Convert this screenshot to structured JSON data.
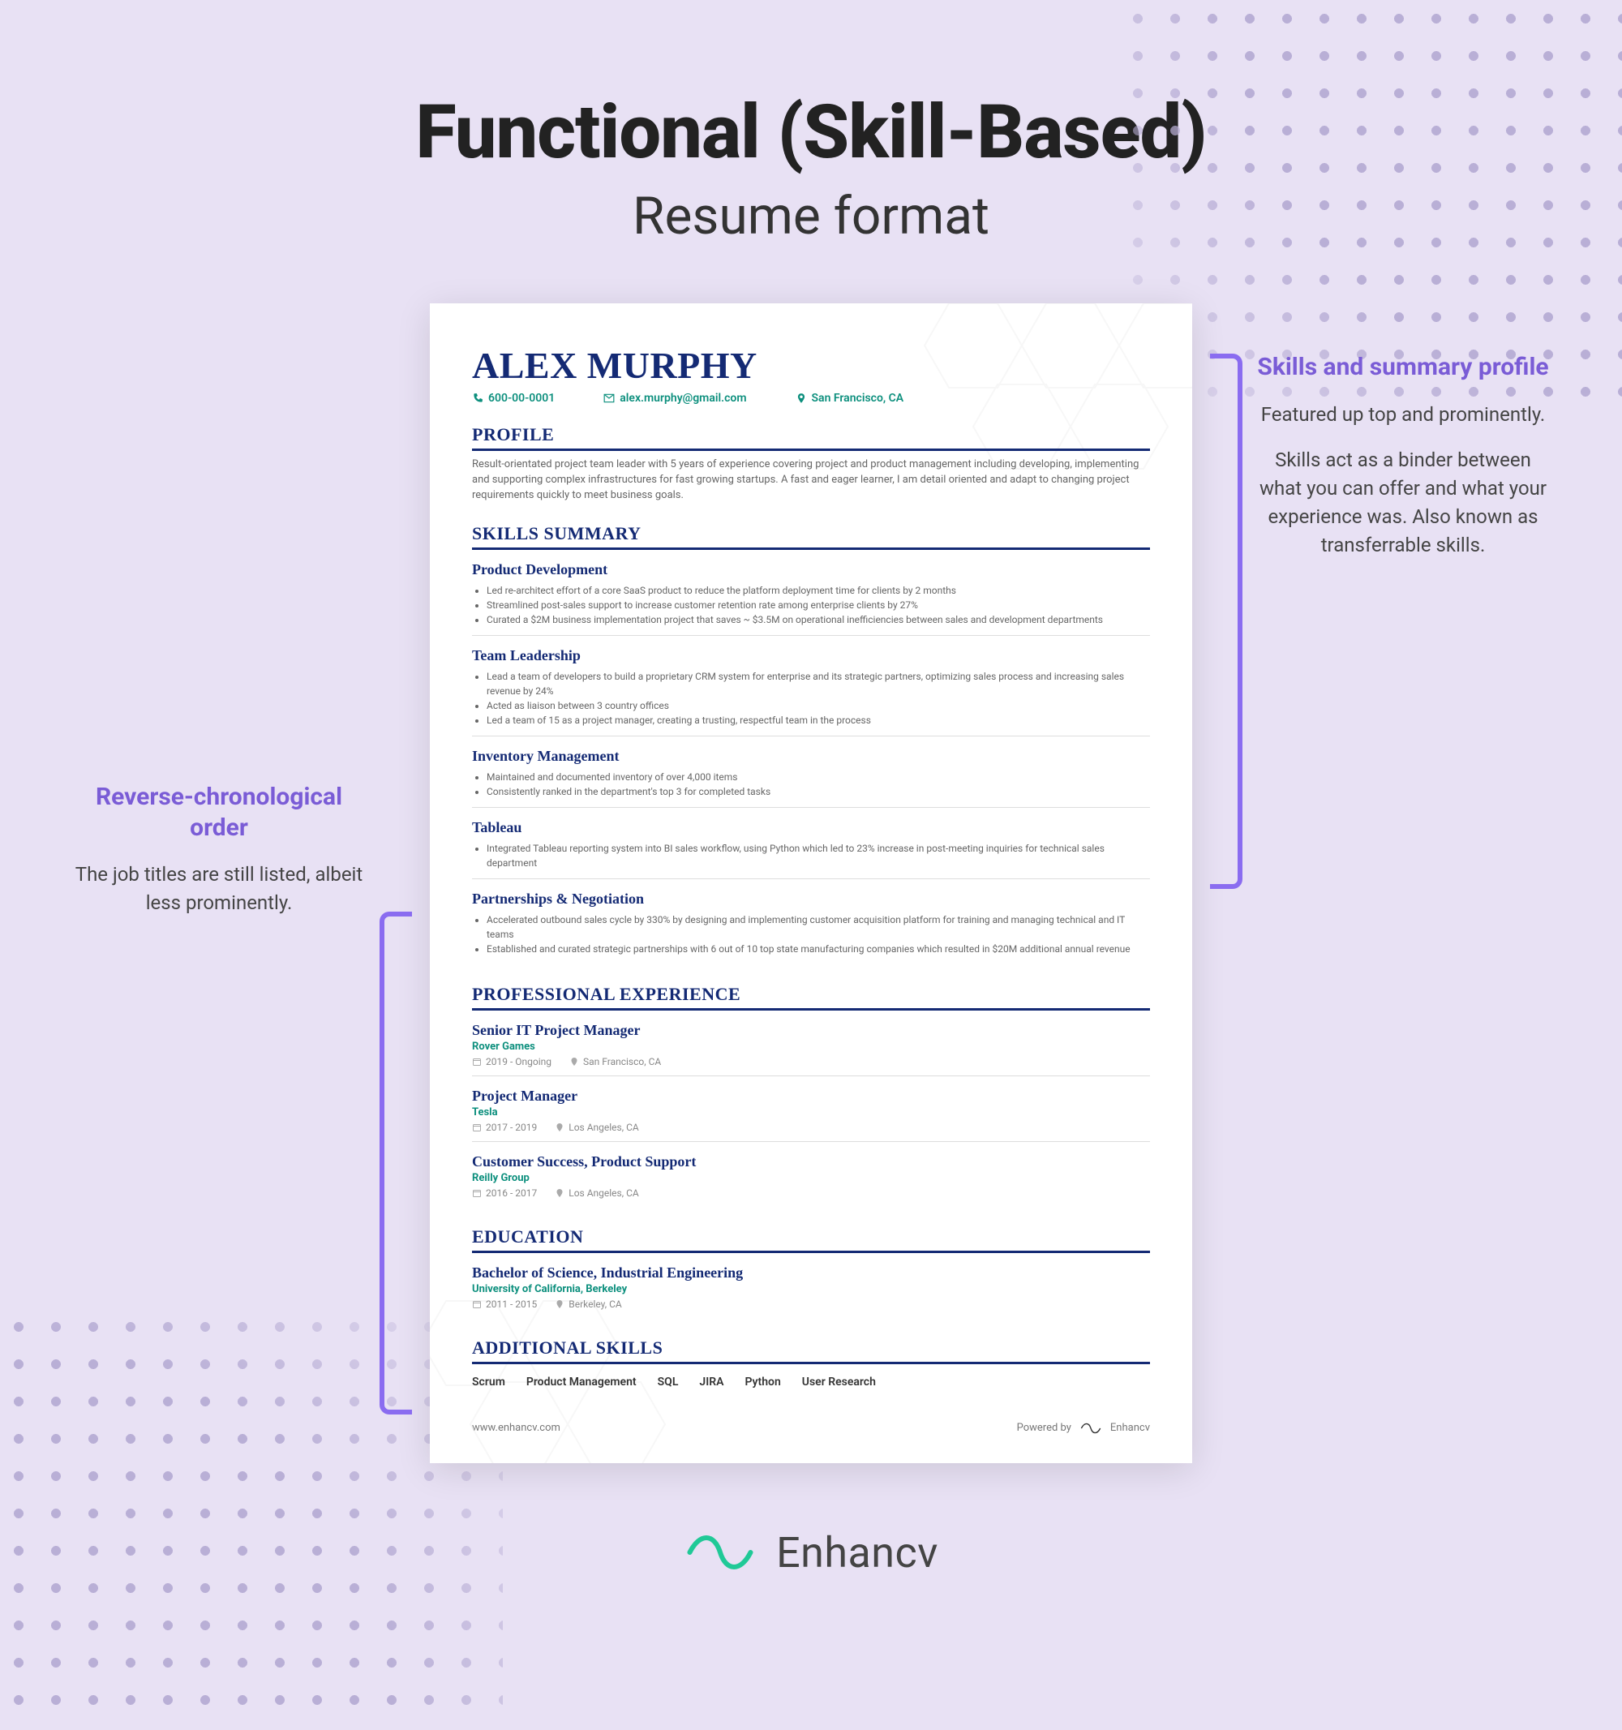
{
  "heading": {
    "title": "Functional (Skill-Based)",
    "subtitle": "Resume format"
  },
  "annotations": {
    "right": {
      "title": "Skills and summary profile",
      "body1": "Featured up top and prominently.",
      "body2": "Skills act as a binder between what you can offer and what your experience was. Also known as transferrable skills."
    },
    "left": {
      "title": "Reverse-chronological order",
      "body1": "The job titles are still listed, albeit less prominently."
    }
  },
  "resume": {
    "name": "ALEX MURPHY",
    "contact": {
      "phone": "600-00-0001",
      "email": "alex.murphy@gmail.com",
      "location": "San Francisco, CA"
    },
    "profile_title": "PROFILE",
    "profile": "Result-orientated project team leader with 5 years of experience covering project and product management including developing, implementing and supporting complex infrastructures for fast growing startups. A fast and eager learner, I am detail oriented and adapt to changing project requirements quickly to meet business goals.",
    "skills_title": "SKILLS SUMMARY",
    "skills": [
      {
        "title": "Product Development",
        "bullets": [
          "Led re-architect effort of a core SaaS product to reduce the platform deployment time for clients by 2 months",
          "Streamlined post-sales support to increase customer retention rate among enterprise clients by 27%",
          "Curated a $2M business implementation project that saves ~ $3.5M on operational inefficiencies between sales and development departments"
        ]
      },
      {
        "title": "Team Leadership",
        "bullets": [
          "Lead a team of developers to build a proprietary CRM system for enterprise and its strategic partners, optimizing sales process and increasing sales revenue by 24%",
          "Acted as liaison between 3 country offices",
          "Led a team of 15 as a project manager, creating a trusting, respectful team in the process"
        ]
      },
      {
        "title": "Inventory Management",
        "bullets": [
          "Maintained and documented inventory of over 4,000 items",
          "Consistently ranked in the department's top 3 for completed tasks"
        ]
      },
      {
        "title": "Tableau",
        "bullets": [
          "Integrated Tableau reporting system into BI sales workflow, using Python which led to 23% increase in post-meeting inquiries for technical sales department"
        ]
      },
      {
        "title": "Partnerships & Negotiation",
        "bullets": [
          "Accelerated outbound sales cycle by 330% by designing and implementing customer acquisition platform for training and managing technical and IT teams",
          "Established and curated strategic partnerships with 6 out of 10 top state manufacturing companies which resulted in $20M additional annual revenue"
        ]
      }
    ],
    "exp_title": "PROFESSIONAL EXPERIENCE",
    "experience": [
      {
        "role": "Senior IT Project Manager",
        "org": "Rover Games",
        "dates": "2019 - Ongoing",
        "loc": "San Francisco, CA"
      },
      {
        "role": "Project Manager",
        "org": "Tesla",
        "dates": "2017 - 2019",
        "loc": "Los Angeles, CA"
      },
      {
        "role": "Customer Success, Product Support",
        "org": "Reilly Group",
        "dates": "2016 - 2017",
        "loc": "Los Angeles, CA"
      }
    ],
    "edu_title": "EDUCATION",
    "education": {
      "degree": "Bachelor of Science, Industrial Engineering",
      "school": "University of California, Berkeley",
      "dates": "2011 - 2015",
      "loc": "Berkeley, CA"
    },
    "addl_title": "ADDITIONAL SKILLS",
    "addl": [
      "Scrum",
      "Product Management",
      "SQL",
      "JIRA",
      "Python",
      "User Research"
    ],
    "footer": {
      "site": "www.enhancv.com",
      "powered": "Powered by",
      "brand": "Enhancv"
    }
  },
  "brand": "Enhancv",
  "colors": {
    "accent": "#142a74",
    "teal": "#0c8f7d",
    "purple": "#7a5cd6",
    "bracket": "#8a6cf0",
    "brand": "#20c997"
  }
}
